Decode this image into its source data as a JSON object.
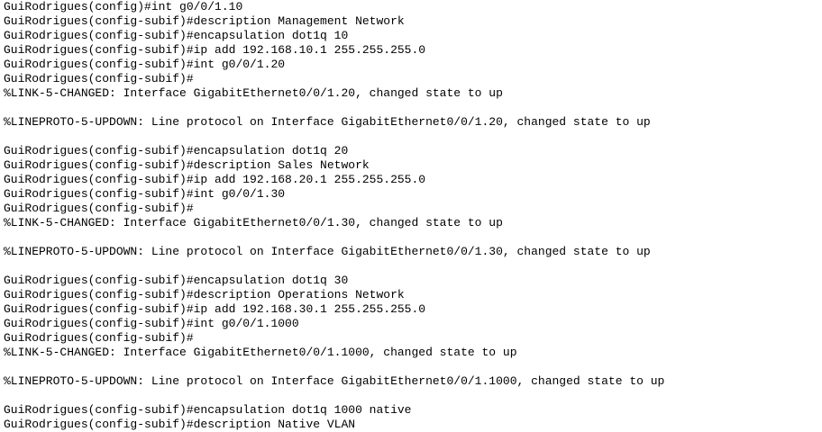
{
  "terminal": {
    "lines": [
      "GuiRodrigues(config)#int g0/0/1.10",
      "GuiRodrigues(config-subif)#description Management Network",
      "GuiRodrigues(config-subif)#encapsulation dot1q 10",
      "GuiRodrigues(config-subif)#ip add 192.168.10.1 255.255.255.0",
      "GuiRodrigues(config-subif)#int g0/0/1.20",
      "GuiRodrigues(config-subif)#",
      "%LINK-5-CHANGED: Interface GigabitEthernet0/0/1.20, changed state to up",
      "",
      "%LINEPROTO-5-UPDOWN: Line protocol on Interface GigabitEthernet0/0/1.20, changed state to up",
      "",
      "GuiRodrigues(config-subif)#encapsulation dot1q 20",
      "GuiRodrigues(config-subif)#description Sales Network",
      "GuiRodrigues(config-subif)#ip add 192.168.20.1 255.255.255.0",
      "GuiRodrigues(config-subif)#int g0/0/1.30",
      "GuiRodrigues(config-subif)#",
      "%LINK-5-CHANGED: Interface GigabitEthernet0/0/1.30, changed state to up",
      "",
      "%LINEPROTO-5-UPDOWN: Line protocol on Interface GigabitEthernet0/0/1.30, changed state to up",
      "",
      "GuiRodrigues(config-subif)#encapsulation dot1q 30",
      "GuiRodrigues(config-subif)#description Operations Network",
      "GuiRodrigues(config-subif)#ip add 192.168.30.1 255.255.255.0",
      "GuiRodrigues(config-subif)#int g0/0/1.1000",
      "GuiRodrigues(config-subif)#",
      "%LINK-5-CHANGED: Interface GigabitEthernet0/0/1.1000, changed state to up",
      "",
      "%LINEPROTO-5-UPDOWN: Line protocol on Interface GigabitEthernet0/0/1.1000, changed state to up",
      "",
      "GuiRodrigues(config-subif)#encapsulation dot1q 1000 native",
      "GuiRodrigues(config-subif)#description Native VLAN"
    ]
  },
  "colors": {
    "background": "#ffffff",
    "text": "#000000"
  }
}
